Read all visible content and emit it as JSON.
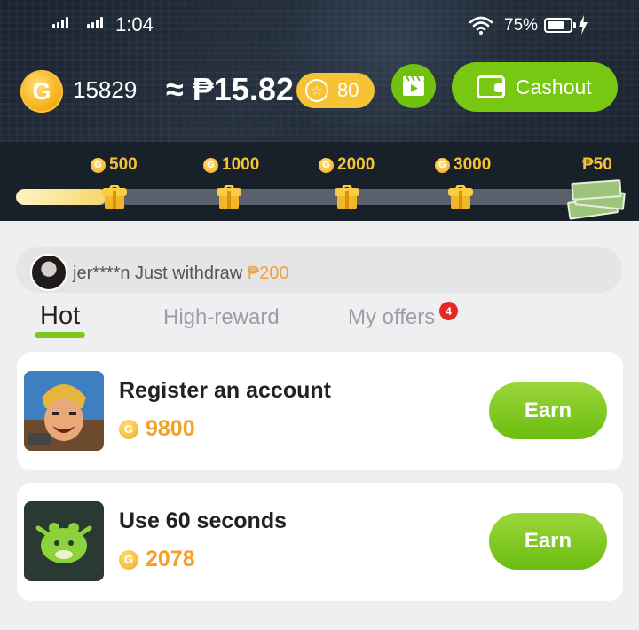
{
  "status_bar": {
    "time": "1:04",
    "battery_percent": "75%",
    "battery_level": 0.75
  },
  "wallet": {
    "coin_balance": "15829",
    "peso_balance": "≈ ₱15.82",
    "coin_symbol": "G",
    "stars": "80",
    "cashout_label": "Cashout"
  },
  "progress": {
    "fill_fraction": 0.15,
    "milestones": [
      {
        "label": "500",
        "type": "coin"
      },
      {
        "label": "1000",
        "type": "coin"
      },
      {
        "label": "2000",
        "type": "coin"
      },
      {
        "label": "3000",
        "type": "coin"
      },
      {
        "label": "₱50",
        "type": "cash"
      }
    ]
  },
  "ticker": {
    "user": "jer****n Just withdraw ",
    "amount": "₱200"
  },
  "tabs": [
    {
      "label": "Hot",
      "active": true
    },
    {
      "label": "High-reward",
      "active": false
    },
    {
      "label": "My offers",
      "active": false,
      "badge": "4"
    }
  ],
  "offers": [
    {
      "title": "Register an account",
      "reward": "9800",
      "earn_label": "Earn",
      "icon": "game-warrior-icon"
    },
    {
      "title": "Use 60 seconds",
      "reward": "2078",
      "earn_label": "Earn",
      "icon": "green-frog-app-icon"
    }
  ],
  "colors": {
    "accent_green": "#77c713",
    "coin_gold": "#f6c236",
    "reward_orange": "#f5a024",
    "badge_red": "#e52a22"
  }
}
